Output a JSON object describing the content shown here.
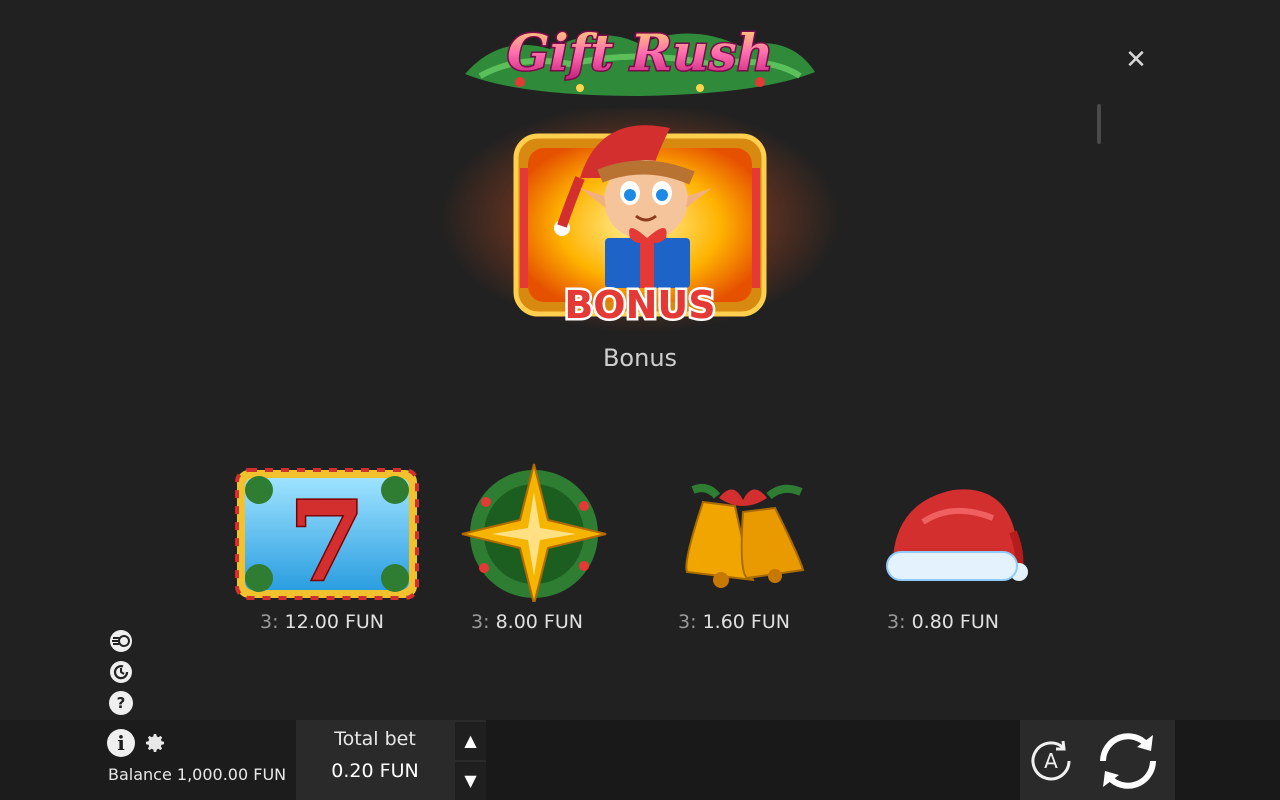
{
  "game": {
    "title": "Gift Rush"
  },
  "paytable": {
    "bonus_caption": "Bonus",
    "bonus_badge": "BONUS",
    "seven_glyph": "7",
    "symbols": [
      {
        "name": "seven",
        "count": "3:",
        "amount": "12.00 FUN"
      },
      {
        "name": "star",
        "count": "3:",
        "amount": "8.00 FUN"
      },
      {
        "name": "bells",
        "count": "3:",
        "amount": "1.60 FUN"
      },
      {
        "name": "santa-hat",
        "count": "3:",
        "amount": "0.80 FUN"
      }
    ]
  },
  "controls": {
    "close_glyph": "✕",
    "info_glyph": "i",
    "help_glyph": "?",
    "balance": "Balance 1,000.00 FUN",
    "total_bet_label": "Total bet",
    "total_bet_value": "0.20 FUN",
    "bet_up_glyph": "▲",
    "bet_down_glyph": "▼",
    "auto_glyph": "A"
  },
  "icons": [
    "turbo-icon",
    "history-icon",
    "help-icon",
    "info-icon",
    "gear-icon",
    "autoplay-icon",
    "spin-icon",
    "close-icon"
  ],
  "colors": {
    "background": "#212121",
    "bar": "#191919",
    "panel": "#2a2a2a",
    "accent_pink": "#e8288a",
    "gold": "#f5b400"
  }
}
